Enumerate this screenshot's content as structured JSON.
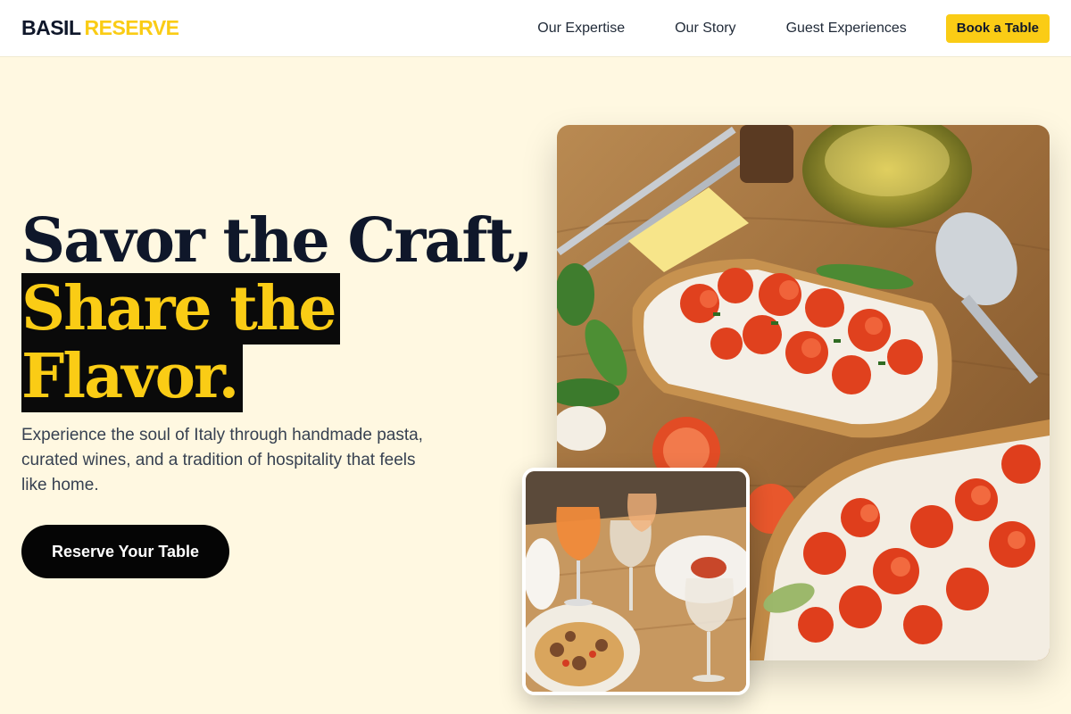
{
  "header": {
    "logo_part1": "BASIL",
    "logo_part2": "RESERVE",
    "nav": [
      "Our Expertise",
      "Our Story",
      "Guest Experiences"
    ],
    "cta_label": "Book a Table"
  },
  "hero": {
    "headline_line1": "Savor the Craft,",
    "headline_highlight": "Share the Flavor.",
    "description": "Experience the soul of Italy through handmade pasta, curated wines, and a tradition of hospitality that feels like home.",
    "cta_label": "Reserve Your Table"
  },
  "images": {
    "main": "bruschetta-with-tomatoes-photo",
    "secondary": "pasta-and-wine-table-photo"
  },
  "colors": {
    "accent": "#facc15",
    "background": "#fff8e1",
    "text": "#0f172a",
    "button_dark": "#050505"
  }
}
